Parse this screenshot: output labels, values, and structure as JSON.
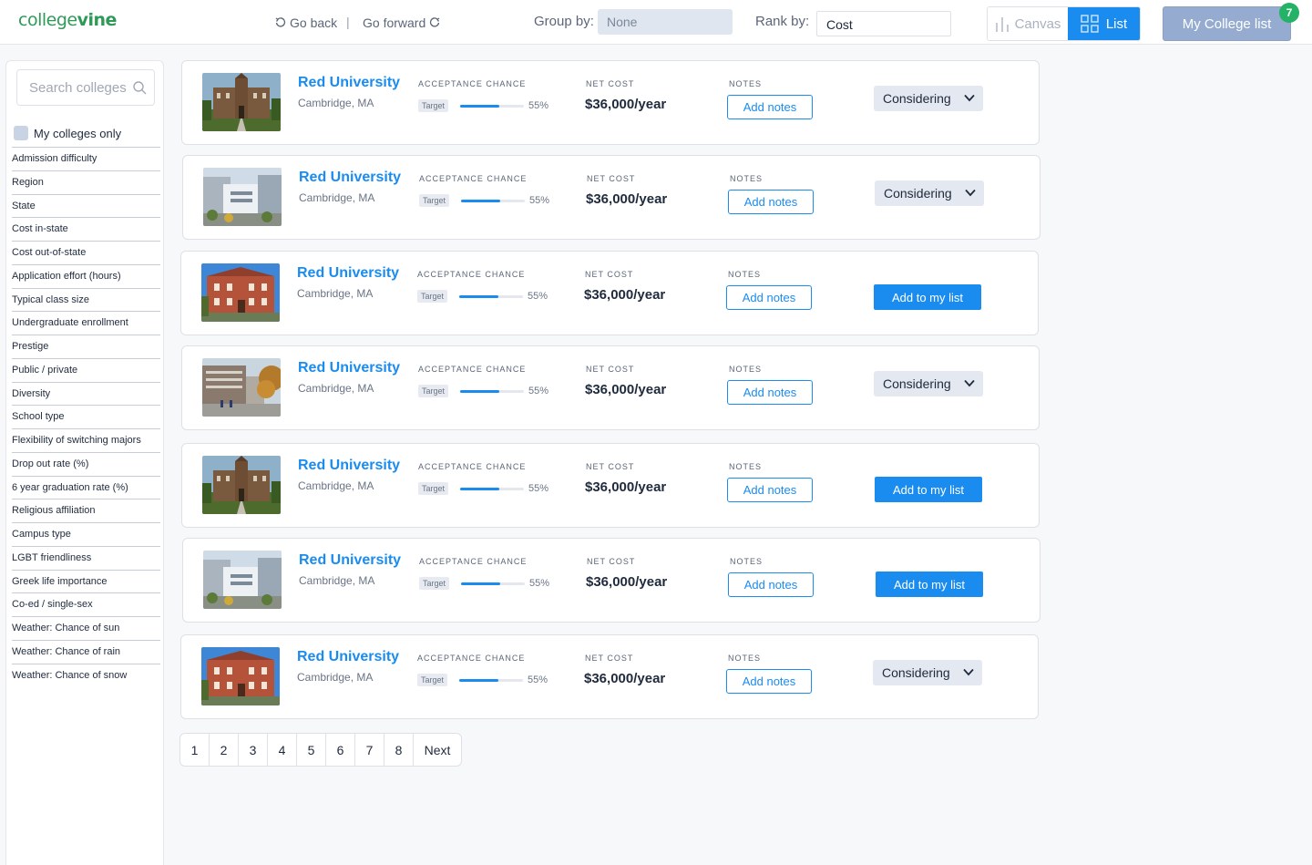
{
  "header": {
    "logo_part1": "college",
    "logo_part2": "vine",
    "go_back": "Go back",
    "separator": "|",
    "go_forward": "Go forward",
    "group_by_label": "Group by:",
    "group_by_value": "None",
    "rank_by_label": "Rank by:",
    "rank_by_value": "Cost",
    "view_canvas": "Canvas",
    "view_list": "List",
    "my_college_list": "My College list",
    "badge_count": "7",
    "accent_color": "#1a8cf0",
    "brand_color": "#2f9a58"
  },
  "sidebar": {
    "search_placeholder": "Search colleges",
    "my_colleges_only": "My colleges only",
    "filters": [
      "Admission difficulty",
      "Region",
      "State",
      "Cost in-state",
      "Cost out-of-state",
      "Application effort (hours)",
      "Typical class size",
      "Undergraduate enrollment",
      "Prestige",
      "Public / private",
      "Diversity",
      "School type",
      "Flexibility of switching majors",
      "Drop out rate (%)",
      "6 year graduation rate (%)",
      "Religious affiliation",
      "Campus type",
      "LGBT friendliness",
      "Greek life importance",
      "Co-ed / single-sex",
      "Weather: Chance of sun",
      "Weather: Chance of rain",
      "Weather: Chance of snow"
    ]
  },
  "labels": {
    "acceptance_chance": "ACCEPTANCE CHANCE",
    "net_cost": "NET COST",
    "notes": "NOTES",
    "add_notes": "Add notes",
    "add_to_list": "Add to my list"
  },
  "colleges": [
    {
      "name": "Red University",
      "location": "Cambridge, MA",
      "tag": "Target",
      "chance": "55%",
      "chance_fraction": 0.62,
      "cost": "$36,000/year",
      "status": "Considering",
      "image": "chapel"
    },
    {
      "name": "Red University",
      "location": "Cambridge, MA",
      "tag": "Target",
      "chance": "55%",
      "chance_fraction": 0.62,
      "cost": "$36,000/year",
      "status": "Considering",
      "image": "modern"
    },
    {
      "name": "Red University",
      "location": "Cambridge, MA",
      "tag": "Target",
      "chance": "55%",
      "chance_fraction": 0.62,
      "cost": "$36,000/year",
      "status": "Add to my list",
      "image": "brick"
    },
    {
      "name": "Red University",
      "location": "Cambridge, MA",
      "tag": "Target",
      "chance": "55%",
      "chance_fraction": 0.62,
      "cost": "$36,000/year",
      "status": "Considering",
      "image": "street"
    },
    {
      "name": "Red University",
      "location": "Cambridge, MA",
      "tag": "Target",
      "chance": "55%",
      "chance_fraction": 0.62,
      "cost": "$36,000/year",
      "status": "Add to my list",
      "image": "chapel"
    },
    {
      "name": "Red University",
      "location": "Cambridge, MA",
      "tag": "Target",
      "chance": "55%",
      "chance_fraction": 0.62,
      "cost": "$36,000/year",
      "status": "Add to my list",
      "image": "modern"
    },
    {
      "name": "Red University",
      "location": "Cambridge, MA",
      "tag": "Target",
      "chance": "55%",
      "chance_fraction": 0.62,
      "cost": "$36,000/year",
      "status": "Considering",
      "image": "brick"
    }
  ],
  "pagination": {
    "pages": [
      "1",
      "2",
      "3",
      "4",
      "5",
      "6",
      "7",
      "8"
    ],
    "next": "Next"
  }
}
